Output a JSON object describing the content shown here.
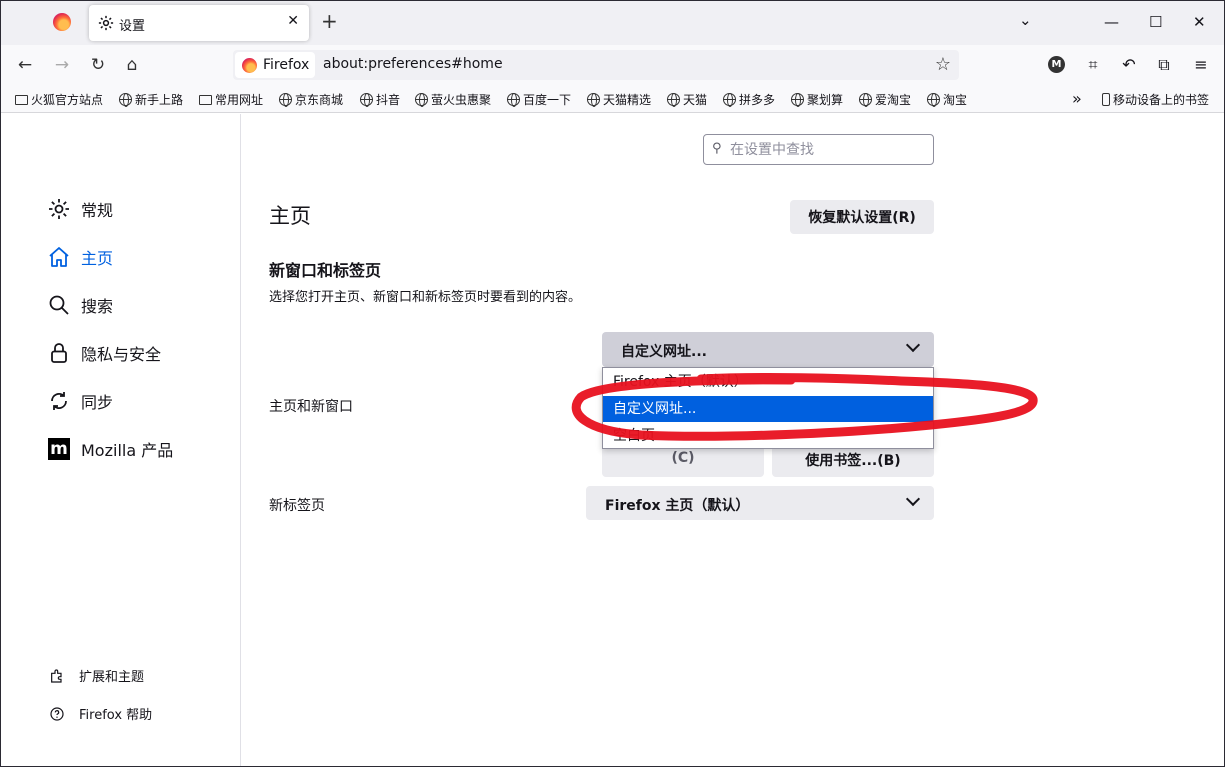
{
  "browser": {
    "tab_title": "设置",
    "url_identity": "Firefox",
    "url": "about:preferences#home"
  },
  "bookmarks": [
    {
      "label": "火狐官方站点",
      "icon": "folder-icon"
    },
    {
      "label": "新手上路",
      "icon": "globe-icon"
    },
    {
      "label": "常用网址",
      "icon": "folder-icon"
    },
    {
      "label": "京东商城",
      "icon": "globe-icon"
    },
    {
      "label": "抖音",
      "icon": "globe-icon"
    },
    {
      "label": "萤火虫惠聚",
      "icon": "globe-icon"
    },
    {
      "label": "百度一下",
      "icon": "globe-icon"
    },
    {
      "label": "天猫精选",
      "icon": "globe-icon"
    },
    {
      "label": "天猫",
      "icon": "globe-icon"
    },
    {
      "label": "拼多多",
      "icon": "globe-icon"
    },
    {
      "label": "聚划算",
      "icon": "globe-icon"
    },
    {
      "label": "爱淘宝",
      "icon": "globe-icon"
    },
    {
      "label": "淘宝",
      "icon": "globe-icon"
    }
  ],
  "bookmarks_mobile": "移动设备上的书签",
  "sidebar": {
    "categories": [
      {
        "label": "常规",
        "icon": "gear-icon"
      },
      {
        "label": "主页",
        "icon": "home-icon"
      },
      {
        "label": "搜索",
        "icon": "search-icon"
      },
      {
        "label": "隐私与安全",
        "icon": "lock-icon"
      },
      {
        "label": "同步",
        "icon": "sync-icon"
      },
      {
        "label": "Mozilla 产品",
        "icon": "mozilla-icon"
      }
    ],
    "footer": [
      {
        "label": "扩展和主题",
        "icon": "puzzle-icon"
      },
      {
        "label": "Firefox 帮助",
        "icon": "help-icon"
      }
    ]
  },
  "search": {
    "placeholder": "在设置中查找"
  },
  "main": {
    "title": "主页",
    "restore_label": "恢复默认设置(R)",
    "section_heading": "新窗口和标签页",
    "section_desc": "选择您打开主页、新窗口和新标签页时要看到的内容。",
    "homepage_label": "主页和新窗口",
    "homepage_value": "自定义网址...",
    "homepage_options": [
      "Firefox 主页（默认）",
      "自定义网址...",
      "空白页"
    ],
    "use_current_label": "(C)",
    "use_bookmark_label": "使用书签...(B)",
    "newtab_label": "新标签页",
    "newtab_value": "Firefox 主页（默认）"
  },
  "colors": {
    "accent": "#0061e0",
    "highlight": "#0060df",
    "annotation": "#e8111f"
  }
}
